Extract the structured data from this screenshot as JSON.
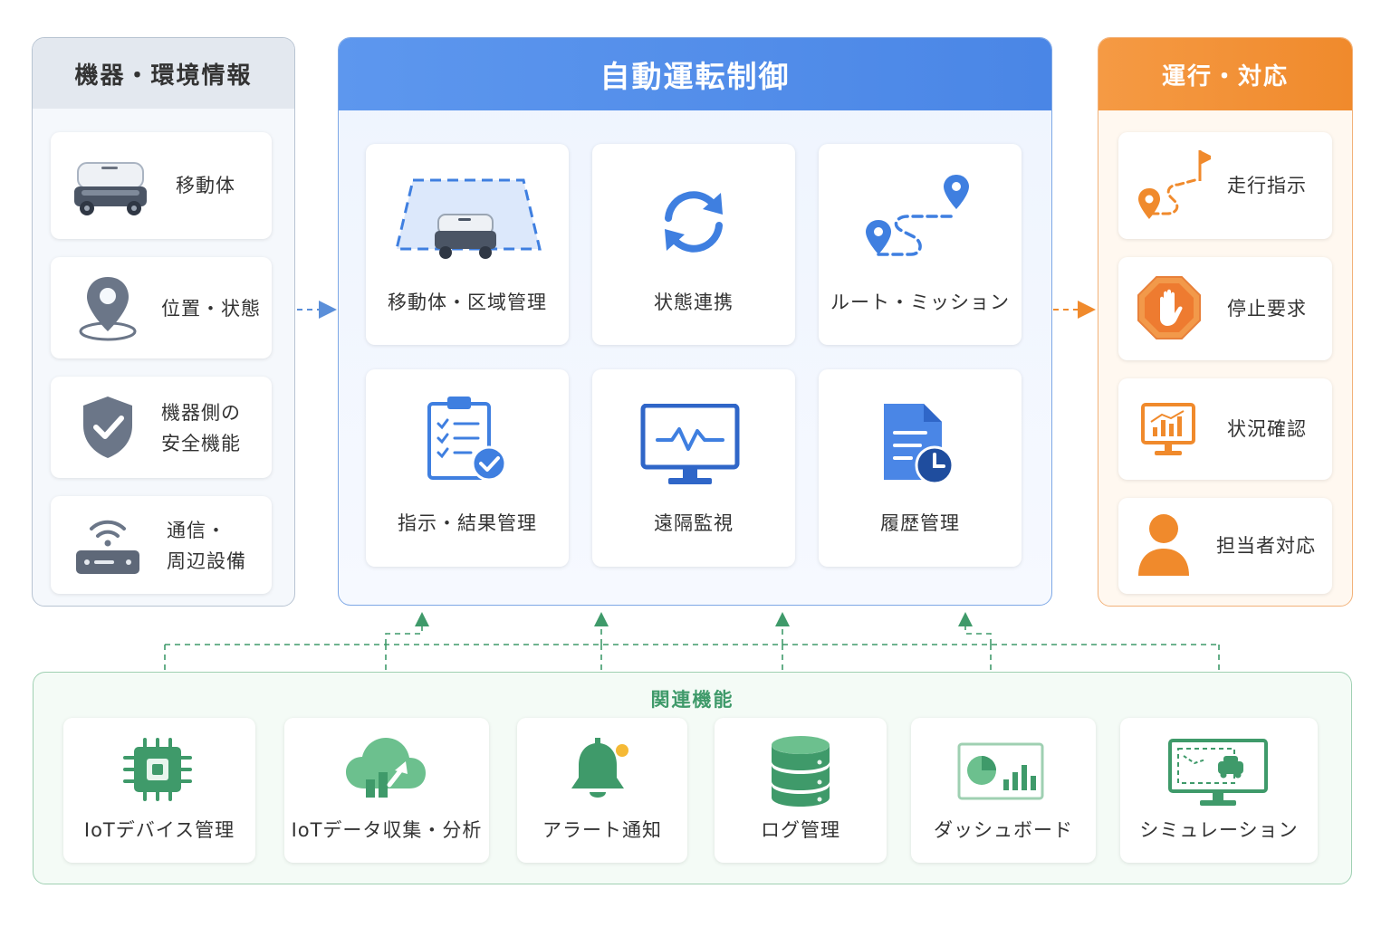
{
  "left_panel": {
    "title": "機器・環境情報",
    "items": [
      {
        "label": "移動体",
        "icon": "robot-vehicle-icon"
      },
      {
        "label": "位置・状態",
        "icon": "location-pin-icon"
      },
      {
        "label_line1": "機器側の",
        "label_line2": "安全機能",
        "icon": "shield-check-icon"
      },
      {
        "label_line1": "通信・",
        "label_line2": "周辺設備",
        "icon": "wifi-router-icon"
      }
    ]
  },
  "center_panel": {
    "title": "自動運転制御",
    "items": [
      {
        "label": "移動体・区域管理",
        "icon": "zone-vehicle-icon"
      },
      {
        "label": "状態連携",
        "icon": "sync-icon"
      },
      {
        "label": "ルート・ミッション",
        "icon": "route-icon"
      },
      {
        "label": "指示・結果管理",
        "icon": "clipboard-check-icon"
      },
      {
        "label": "遠隔監視",
        "icon": "monitor-pulse-icon"
      },
      {
        "label": "履歴管理",
        "icon": "document-clock-icon"
      }
    ]
  },
  "right_panel": {
    "title": "運行・対応",
    "items": [
      {
        "label": "走行指示",
        "icon": "route-flag-icon"
      },
      {
        "label": "停止要求",
        "icon": "stop-hand-icon"
      },
      {
        "label": "状況確認",
        "icon": "chart-monitor-icon"
      },
      {
        "label": "担当者対応",
        "icon": "person-icon"
      }
    ]
  },
  "bottom_panel": {
    "title": "関連機能",
    "items": [
      {
        "label": "IoTデバイス管理",
        "icon": "chip-icon"
      },
      {
        "label": "IoTデータ収集・分析",
        "icon": "cloud-analytics-icon"
      },
      {
        "label": "アラート通知",
        "icon": "bell-icon"
      },
      {
        "label": "ログ管理",
        "icon": "database-icon"
      },
      {
        "label": "ダッシュボード",
        "icon": "dashboard-icon"
      },
      {
        "label": "シミュレーション",
        "icon": "simulation-monitor-icon"
      }
    ]
  },
  "colors": {
    "gray_accent": "#6b7280",
    "blue_accent": "#3f7fe0",
    "orange_accent": "#f08a2c",
    "green_accent": "#3f9a6a"
  }
}
